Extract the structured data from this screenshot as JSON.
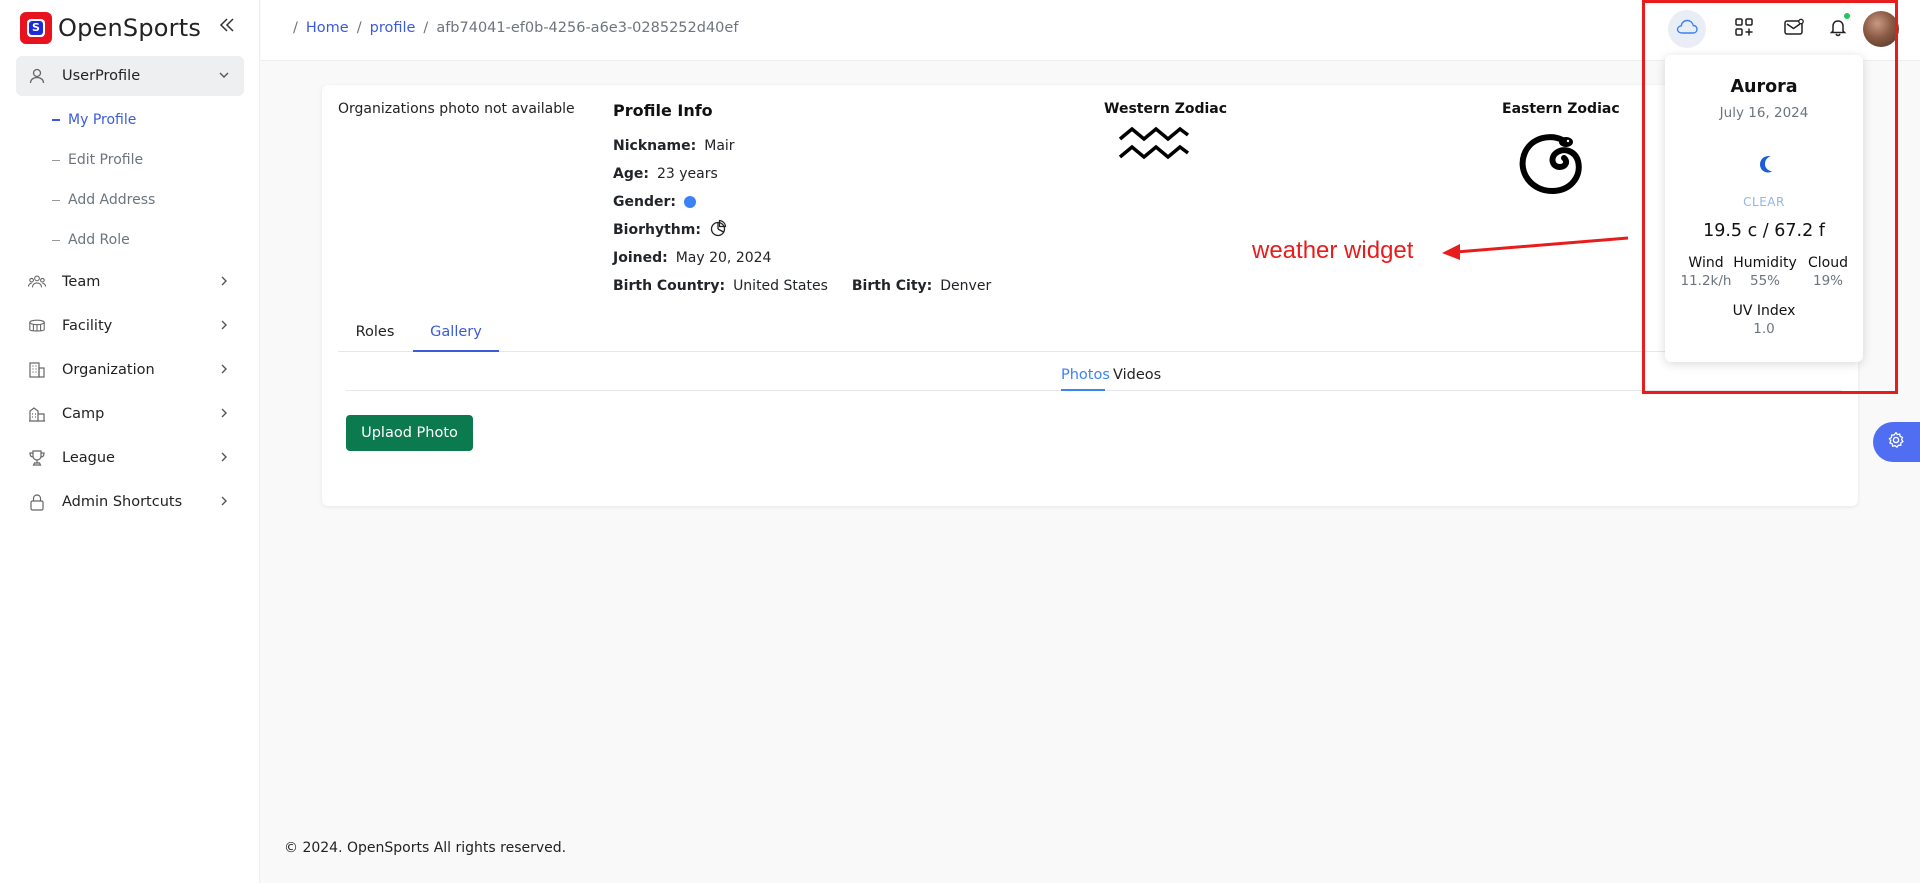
{
  "brand": {
    "name": "OpenSports",
    "logo_letter": "S"
  },
  "sidebar": {
    "items": [
      {
        "label": "UserProfile",
        "icon": "user-icon",
        "expanded": true
      },
      {
        "label": "Team",
        "icon": "team-icon"
      },
      {
        "label": "Facility",
        "icon": "stadium-icon"
      },
      {
        "label": "Organization",
        "icon": "building-icon"
      },
      {
        "label": "Camp",
        "icon": "camp-icon"
      },
      {
        "label": "League",
        "icon": "trophy-icon"
      },
      {
        "label": "Admin Shortcuts",
        "icon": "lock-icon"
      }
    ],
    "subitems": [
      {
        "label": "My Profile",
        "active": true
      },
      {
        "label": "Edit Profile"
      },
      {
        "label": "Add Address"
      },
      {
        "label": "Add Role"
      }
    ]
  },
  "breadcrumb": {
    "home": "Home",
    "profile": "profile",
    "id": "afb74041-ef0b-4256-a6e3-0285252d40ef"
  },
  "topbar": {
    "icons": [
      "cloud-icon",
      "apps-add-icon",
      "mail-icon",
      "bell-icon",
      "avatar"
    ]
  },
  "profile": {
    "org_photo_text": "Organizations photo not available",
    "title": "Profile Info",
    "nickname_label": "Nickname:",
    "nickname": "Mair",
    "age_label": "Age:",
    "age": "23 years",
    "gender_label": "Gender:",
    "gender_color": "#3b82f6",
    "biorhythm_label": "Biorhythm:",
    "joined_label": "Joined:",
    "joined": "May 20, 2024",
    "country_label": "Birth Country:",
    "country": "United States",
    "city_label": "Birth City:",
    "city": "Denver"
  },
  "zodiac": {
    "western_title": "Western Zodiac",
    "western_icon": "aquarius-icon",
    "eastern_title": "Eastern Zodiac",
    "eastern_icon": "snake-icon"
  },
  "tabs": [
    {
      "label": "Roles"
    },
    {
      "label": "Gallery",
      "active": true
    }
  ],
  "gallery_tabs": [
    {
      "label": "Photos",
      "active": true
    },
    {
      "label": "Videos"
    }
  ],
  "upload_button": "Uplaod Photo",
  "annotation": {
    "text": "weather widget",
    "color": "#e81c1c"
  },
  "weather": {
    "city": "Aurora",
    "date": "July 16, 2024",
    "condition": "CLEAR",
    "icon": "moon-icon",
    "temp": "19.5 c / 67.2 f",
    "wind_label": "Wind",
    "wind": "11.2k/h",
    "humidity_label": "Humidity",
    "humidity": "55%",
    "cloud_label": "Cloud",
    "cloud": "19%",
    "uv_label": "UV Index",
    "uv": "1.0"
  },
  "footer": "© 2024. OpenSports All rights reserved.",
  "colors": {
    "accent": "#3b5bdb",
    "primary_button": "#0c7a4f",
    "brand_red": "#e8131e"
  }
}
